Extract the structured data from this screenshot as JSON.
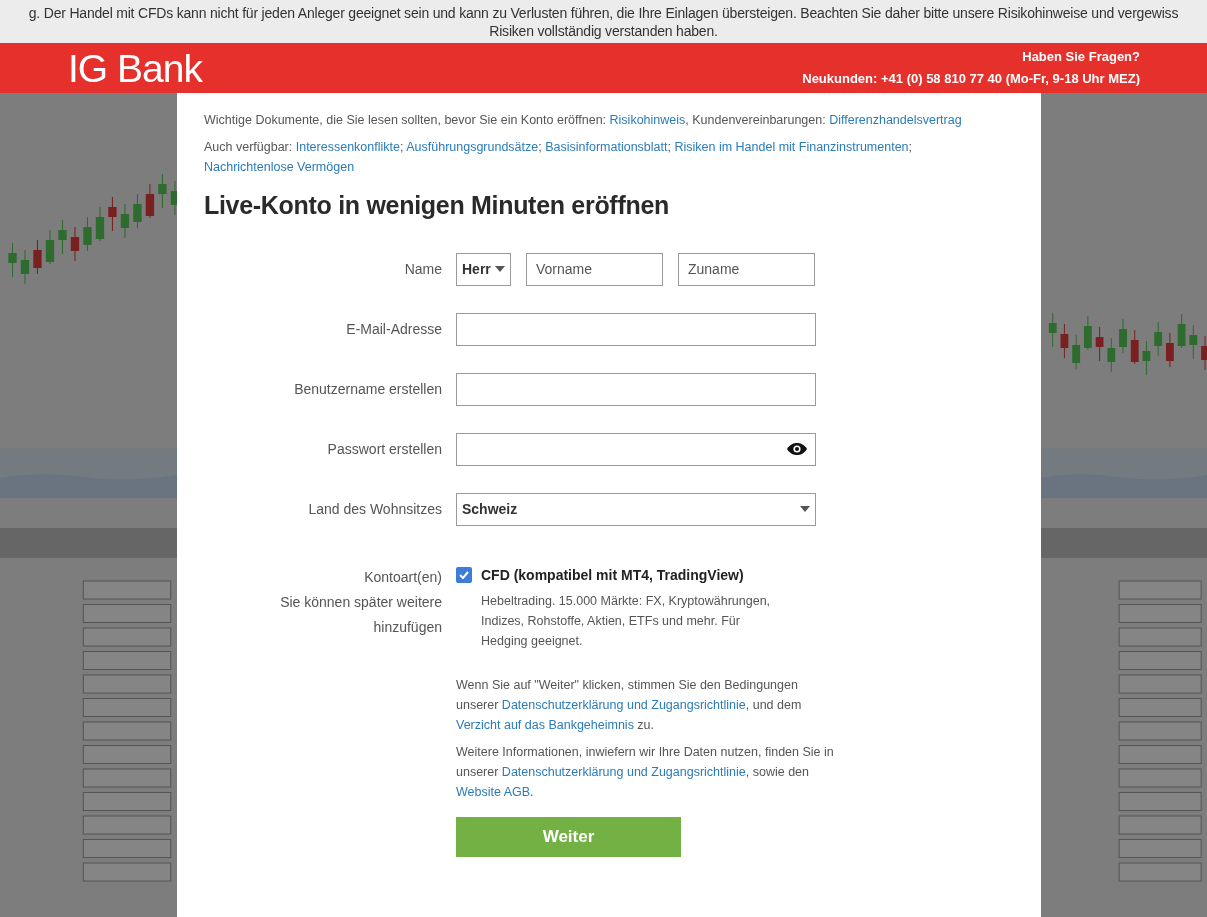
{
  "disclaimer": {
    "lines": [
      "g. Der Handel mit CFDs kann nicht für jeden Anleger geeignet sein und kann zu Verlusten führen, die Ihre Einlagen übersteigen. Beachten Sie daher bitte unsere Risikohinweise und vergewiss",
      "Risiken vollständig verstanden haben."
    ]
  },
  "header": {
    "logo": "IG Bank",
    "question": "Haben Sie Fragen?",
    "phone": "Neukunden: +41 (0) 58 810 77 40 (Mo-Fr, 9-18 Uhr MEZ)"
  },
  "background": {
    "kind": "picture"
  },
  "documents": [
    [
      {
        "kind": "text",
        "text": "Wichtige Dokumente, die Sie lesen sollten, bevor Sie ein Konto eröffnen: "
      },
      {
        "kind": "link",
        "text": "Risikohinweis"
      },
      {
        "kind": "text",
        "text": ", Kundenvereinbarungen: "
      },
      {
        "kind": "link",
        "text": "Differenzhandelsvertrag"
      }
    ],
    [
      {
        "kind": "text",
        "text": "Auch verfügbar: "
      },
      {
        "kind": "link",
        "text": "Interessenkonflikte"
      },
      {
        "kind": "text",
        "text": "; "
      },
      {
        "kind": "link",
        "text": "Ausführungsgrundsätze"
      },
      {
        "kind": "text",
        "text": "; "
      },
      {
        "kind": "link",
        "text": "Basisinformationsblatt"
      },
      {
        "kind": "text",
        "text": "; "
      },
      {
        "kind": "link",
        "text": "Risiken im Handel mit Finanzinstrumenten"
      },
      {
        "kind": "text",
        "text": "; "
      },
      {
        "kind": "link",
        "text": "Nachrichtenlose Vermögen"
      }
    ]
  ],
  "title": "Live-Konto in wenigen Minuten eröffnen",
  "fields": [
    {
      "kind": "name",
      "label": "Name",
      "salutation": "Herr",
      "first_placeholder": "Vorname",
      "last_placeholder": "Zuname"
    },
    {
      "kind": "text",
      "label": "E-Mail-Adresse"
    },
    {
      "kind": "text",
      "label": "Benutzername erstellen"
    },
    {
      "kind": "password",
      "label": "Passwort erstellen"
    },
    {
      "kind": "select",
      "label": "Land des Wohnsitzes",
      "value": "Schweiz"
    }
  ],
  "account": {
    "label": "Kontoart(en)",
    "hint": "Sie können später weitere hinzufügen",
    "option": {
      "label": "CFD (kompatibel mit MT4, TradingView)",
      "checked": true,
      "description": "Hebeltrading. 15.000 Märkte: FX, Kryptowährungen, Indizes, Rohstoffe, Aktien, ETFs und mehr. Für Hedging geeignet."
    }
  },
  "notes": [
    [
      {
        "kind": "text",
        "text": "Wenn Sie auf \"Weiter\" klicken, stimmen Sie den Bedingungen unserer "
      },
      {
        "kind": "link",
        "text": "Datenschutzerklärung und Zugangsrichtlinie"
      },
      {
        "kind": "text",
        "text": ", und dem "
      },
      {
        "kind": "link",
        "text": "Verzicht auf das Bankgeheimnis"
      },
      {
        "kind": "text",
        "text": " zu."
      }
    ],
    [
      {
        "kind": "text",
        "text": "Weitere Informationen, inwiefern wir Ihre Daten nutzen, finden Sie in unserer "
      },
      {
        "kind": "link",
        "text": "Datenschutzerklärung und Zugangsrichtlinie"
      },
      {
        "kind": "text",
        "text": ", sowie den "
      },
      {
        "kind": "link",
        "text": "Website AGB"
      },
      {
        "kind": "text",
        "text": "."
      }
    ]
  ],
  "submit": "Weiter"
}
